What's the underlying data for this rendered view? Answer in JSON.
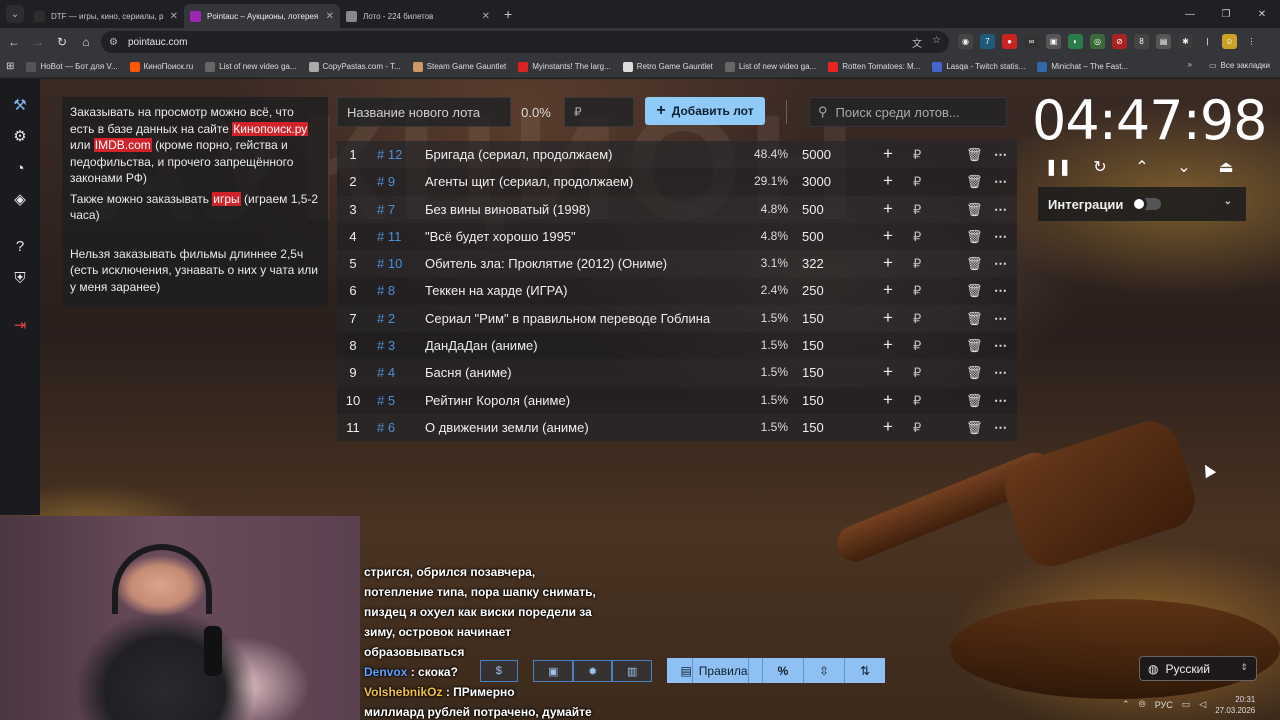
{
  "browser": {
    "tabs": [
      {
        "title": "DTF — игры, кино, сериалы, р",
        "icon_color": "#2d2d2d",
        "active": false
      },
      {
        "title": "Pointauc – Аукционы, лотерея",
        "icon_color": "#9c27b0",
        "active": true
      },
      {
        "title": "Лото - 224 билетов",
        "icon_color": "#888888",
        "active": false
      }
    ],
    "new_tab": "+",
    "url": "pointauc.com",
    "bookmarks": [
      {
        "label": "HoBot — Бот для V...",
        "color": "#555"
      },
      {
        "label": "КиноПоиск.ru",
        "color": "#f50"
      },
      {
        "label": "List of new video ga...",
        "color": "#666"
      },
      {
        "label": "CopyPastas.com - T...",
        "color": "#aaa"
      },
      {
        "label": "Steam Game Gauntlet",
        "color": "#c96"
      },
      {
        "label": "Myinstants! The larg...",
        "color": "#d22"
      },
      {
        "label": "Retro Game Gauntlet",
        "color": "#ddd"
      },
      {
        "label": "List of new video ga...",
        "color": "#666"
      },
      {
        "label": "Rotten Tomatoes: M...",
        "color": "#e22"
      },
      {
        "label": "Lasqa - Twitch statis...",
        "color": "#46c"
      },
      {
        "label": "Minichat – The Fast...",
        "color": "#36a"
      }
    ],
    "bookmarks_more": "»",
    "all_bookmarks": "Все закладки"
  },
  "rules": {
    "p1_a": "Заказывать на просмотр можно всё, что есть в базе данных на сайте ",
    "p1_link1": "Кинопоиск.ру",
    "p1_b": " или ",
    "p1_link2": "IMDB.com",
    "p1_c": " (кроме порно, гейства и педофильства, и прочего запрещённого законами РФ)",
    "p2_a": "Также можно заказывать ",
    "p2_link": "игры",
    "p2_b": " (играем 1,5-2 часа)",
    "p3": "Нельзя заказывать фильмы длиннее 2,5ч (есть исключения, узнавать о них у чата или у меня заранее)"
  },
  "controls": {
    "lot_placeholder": "Название нового лота",
    "pct": "0.0%",
    "currency": "₽",
    "add_label": "Добавить лот",
    "search_placeholder": "Поиск среди лотов..."
  },
  "lots": [
    {
      "rank": "1",
      "id": "# 12",
      "name": "Бригада (сериал, продолжаем)",
      "pct": "48.4%",
      "amount": "5000"
    },
    {
      "rank": "2",
      "id": "# 9",
      "name": "Агенты щит (сериал, продолжаем)",
      "pct": "29.1%",
      "amount": "3000"
    },
    {
      "rank": "3",
      "id": "# 7",
      "name": "Без вины виноватый (1998)",
      "pct": "4.8%",
      "amount": "500"
    },
    {
      "rank": "4",
      "id": "# 11",
      "name": "\"Всё будет хорошо 1995\"",
      "pct": "4.8%",
      "amount": "500"
    },
    {
      "rank": "5",
      "id": "# 10",
      "name": "Обитель зла: Проклятие (2012) (Ониме)",
      "pct": "3.1%",
      "amount": "322"
    },
    {
      "rank": "6",
      "id": "# 8",
      "name": "Теккен на харде (ИГРА)",
      "pct": "2.4%",
      "amount": "250"
    },
    {
      "rank": "7",
      "id": "# 2",
      "name": "Сериал \"Рим\" в правильном переводе Гоблина",
      "pct": "1.5%",
      "amount": "150"
    },
    {
      "rank": "8",
      "id": "# 3",
      "name": "ДанДаДан (аниме)",
      "pct": "1.5%",
      "amount": "150"
    },
    {
      "rank": "9",
      "id": "# 4",
      "name": "Басня (аниме)",
      "pct": "1.5%",
      "amount": "150"
    },
    {
      "rank": "10",
      "id": "# 5",
      "name": "Рейтинг Короля (аниме)",
      "pct": "1.5%",
      "amount": "150"
    },
    {
      "rank": "11",
      "id": "# 6",
      "name": "О движении земли (аниме)",
      "pct": "1.5%",
      "amount": "150"
    }
  ],
  "timer": {
    "value": "04:47:98"
  },
  "integrations": {
    "label": "Интеграции"
  },
  "chat": {
    "lines": [
      "стригся, обрился позавчера,",
      "потепление типа, пора шапку снимать,",
      "пиздец я охуел как виски поредели за",
      "зиму, островок начинает",
      "образовываться"
    ],
    "msg2_nick": "Denvox",
    "msg2_text": "скока?",
    "msg3_nick": "VolshebnikOz",
    "msg3_text": "ПРимерно",
    "msg3_line2": "миллиард рублей потрачено, думайте"
  },
  "bottom": {
    "rules_label": "Правила",
    "pct_symbol": "%",
    "language": "Русский"
  },
  "tray": {
    "lang": "РУС",
    "time": "20:31",
    "date": "27.03.2026"
  }
}
